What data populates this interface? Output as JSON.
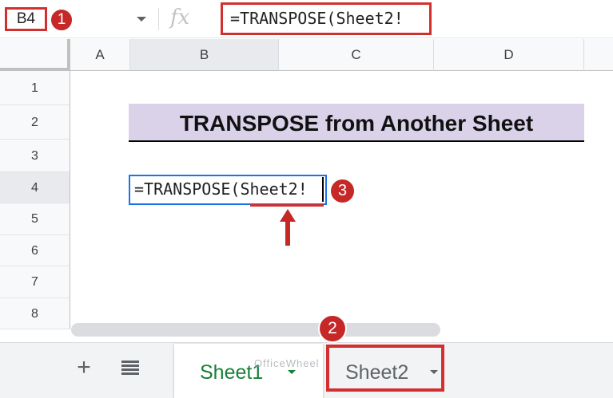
{
  "formula_bar": {
    "name_box": "B4",
    "fx_label": "fx",
    "formula": "=TRANSPOSE(Sheet2!"
  },
  "columns": [
    "A",
    "B",
    "C",
    "D"
  ],
  "rows": [
    "1",
    "2",
    "3",
    "4",
    "5",
    "6",
    "7",
    "8"
  ],
  "selected_cell": {
    "column": "B",
    "row": "4"
  },
  "cells": {
    "B2": "TRANSPOSE from Another Sheet",
    "B4": "=TRANSPOSE(Sheet2!"
  },
  "annotations": {
    "badge_1": "1",
    "badge_2": "2",
    "badge_3": "3"
  },
  "tab_bar": {
    "add_label": "+",
    "tabs": [
      {
        "label": "Sheet1",
        "active": true
      },
      {
        "label": "Sheet2",
        "active": false
      }
    ]
  },
  "watermark": "OfficeWheel",
  "colors": {
    "highlight_red": "#d32f2f",
    "badge_red": "#c62828",
    "title_fill": "#d9d2e9",
    "active_tab_green": "#188038",
    "edit_border_blue": "#1a73e8"
  }
}
